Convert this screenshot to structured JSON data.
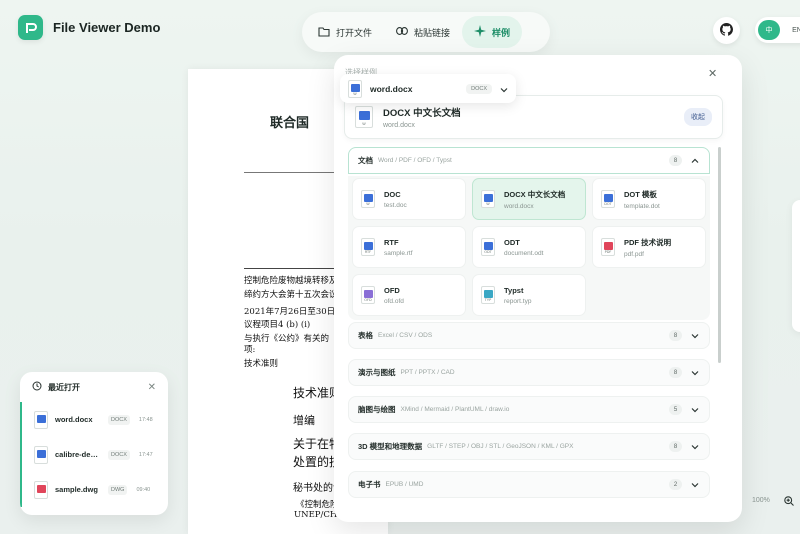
{
  "app": {
    "title": "File Viewer Demo",
    "brand_color": "#2fb88a"
  },
  "toolbar": {
    "open_label": "打开文件",
    "paste_label": "粘贴链接",
    "sample_label": "样例"
  },
  "lang": {
    "zh": "中",
    "en": "EN"
  },
  "doc": {
    "heading": "联合国",
    "lines": [
      "控制危险废物越境转移及",
      "缔约方大会第十五次会议",
      "2021年7月26日至30日和",
      "议程项目4 (b) (i)",
      "与执行《公约》有关的",
      "项:",
      "技术准则"
    ],
    "big_lines": [
      "技术准则",
      "增编",
      "关于在特",
      "处置的技"
    ],
    "more_lines": [
      "秘书处的说",
      "《控制危险",
      "UNEP/CHW"
    ]
  },
  "zoom": {
    "level": "100%"
  },
  "recent": {
    "title": "最近打开",
    "items": [
      {
        "name": "word.docx",
        "type": "DOCX",
        "time": "17:48",
        "icon": "word-icon",
        "color": "#3b6fd8"
      },
      {
        "name": "calibre-demo.docx",
        "type": "DOCX",
        "time": "17:47",
        "icon": "word-icon",
        "color": "#3b6fd8"
      },
      {
        "name": "sample.dwg",
        "type": "DWG",
        "time": "09:40",
        "icon": "dwg-icon",
        "color": "#e0455a"
      }
    ]
  },
  "panel": {
    "ghost_text": "选择样例",
    "selector": {
      "name": "word.docx",
      "type": "DOCX"
    },
    "current": {
      "title": "DOCX 中文长文档",
      "file": "word.docx",
      "collapse_label": "收起"
    },
    "categories": [
      {
        "name": "文档",
        "types": "Word / PDF / OFD / Typst",
        "count": "8",
        "open": true
      },
      {
        "name": "表格",
        "types": "Excel / CSV / ODS",
        "count": "8",
        "open": false
      },
      {
        "name": "演示与图纸",
        "types": "PPT / PPTX / CAD",
        "count": "8",
        "open": false
      },
      {
        "name": "脑图与绘图",
        "types": "XMind / Mermaid / PlantUML / draw.io",
        "count": "5",
        "open": false
      },
      {
        "name": "3D 模型和地理数据",
        "types": "GLTF / STEP / OBJ / STL / GeoJSON / KML / GPX",
        "count": "8",
        "open": false
      },
      {
        "name": "电子书",
        "types": "EPUB / UMD",
        "count": "2",
        "open": false
      }
    ],
    "samples": [
      {
        "name": "DOC",
        "file": "test.doc",
        "ext": "W",
        "color": "#3b6fd8",
        "selected": false
      },
      {
        "name": "DOCX 中文长文档",
        "file": "word.docx",
        "ext": "W",
        "color": "#3b6fd8",
        "selected": true
      },
      {
        "name": "DOT 模板",
        "file": "template.dot",
        "ext": "DOT",
        "color": "#3b6fd8",
        "selected": false
      },
      {
        "name": "RTF",
        "file": "sample.rtf",
        "ext": "RTF",
        "color": "#3b6fd8",
        "selected": false
      },
      {
        "name": "ODT",
        "file": "document.odt",
        "ext": "ODT",
        "color": "#3b6fd8",
        "selected": false
      },
      {
        "name": "PDF 技术说明",
        "file": "pdf.pdf",
        "ext": "PDF",
        "color": "#e0455a",
        "selected": false
      },
      {
        "name": "OFD",
        "file": "ofd.ofd",
        "ext": "OFD",
        "color": "#8a6fd6",
        "selected": false
      },
      {
        "name": "Typst",
        "file": "report.typ",
        "ext": "TYP",
        "color": "#3aa7c4",
        "selected": false
      }
    ]
  }
}
